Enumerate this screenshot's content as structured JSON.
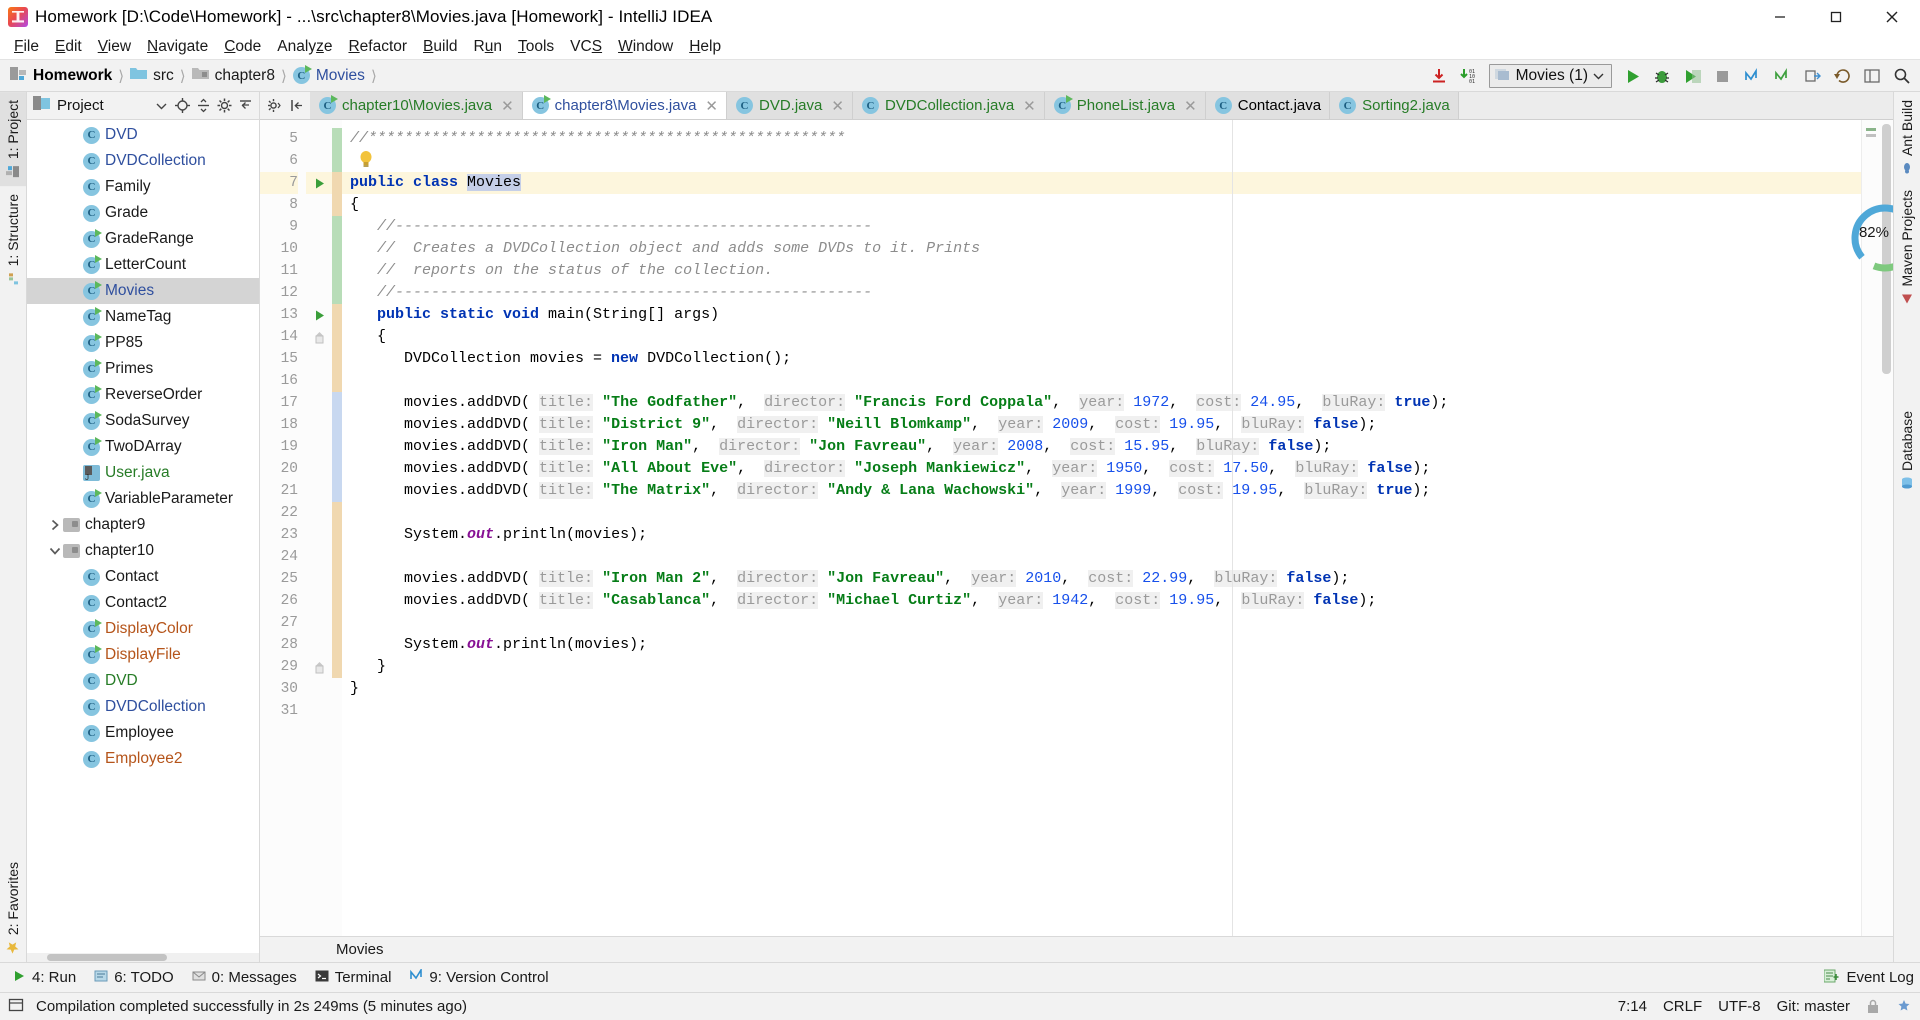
{
  "window": {
    "title": "Homework [D:\\Code\\Homework] - ...\\src\\chapter8\\Movies.java [Homework] - IntelliJ IDEA",
    "app_icon": "intellij-idea-icon",
    "minimize": "minimize-icon",
    "maximize": "maximize-icon",
    "close": "close-icon"
  },
  "menubar": {
    "items": [
      {
        "label": "File",
        "mnemonic": "F"
      },
      {
        "label": "Edit",
        "mnemonic": "E"
      },
      {
        "label": "View",
        "mnemonic": "V"
      },
      {
        "label": "Navigate",
        "mnemonic": "N"
      },
      {
        "label": "Code",
        "mnemonic": "C"
      },
      {
        "label": "Analyze",
        "mnemonic": "z"
      },
      {
        "label": "Refactor",
        "mnemonic": "R"
      },
      {
        "label": "Build",
        "mnemonic": "B"
      },
      {
        "label": "Run",
        "mnemonic": "u"
      },
      {
        "label": "Tools",
        "mnemonic": "T"
      },
      {
        "label": "VCS",
        "mnemonic": "S"
      },
      {
        "label": "Window",
        "mnemonic": "W"
      },
      {
        "label": "Help",
        "mnemonic": "H"
      }
    ]
  },
  "breadcrumb": {
    "items": [
      {
        "label": "Homework",
        "icon": "project-module-icon",
        "style": "project"
      },
      {
        "label": "src",
        "icon": "source-folder-icon",
        "style": "plain"
      },
      {
        "label": "chapter8",
        "icon": "package-folder-icon",
        "style": "plain"
      },
      {
        "label": "Movies",
        "icon": "java-class-icon",
        "style": "blue"
      }
    ]
  },
  "toolbar": {
    "update_project": "update-project-icon",
    "compile": "compile-icon",
    "run_config_label": "Movies (1)",
    "run_config_icon": "run-configuration-icon",
    "run": "run-icon",
    "debug": "debug-icon",
    "coverage": "run-with-coverage-icon",
    "vcs_update": "vcs-update-icon",
    "vcs_commit": "vcs-commit-icon",
    "vcs_push": "vcs-push-icon",
    "undo": "undo-icon",
    "layout": "layout-icon",
    "search": "search-everywhere-icon"
  },
  "left_stripe": {
    "top_tabs": [
      {
        "label": "1: Project",
        "icon": "project-tool-icon",
        "active": true
      },
      {
        "label": "1: Structure",
        "icon": "structure-tool-icon",
        "active": false
      }
    ],
    "bottom_tabs": [
      {
        "label": "2: Favorites",
        "icon": "favorites-star-icon",
        "active": false
      }
    ]
  },
  "right_stripe": {
    "tabs": [
      {
        "label": "Ant Build",
        "icon": "ant-build-icon"
      },
      {
        "label": "Maven Projects",
        "icon": "maven-icon"
      },
      {
        "label": "Database",
        "icon": "database-icon"
      }
    ]
  },
  "project_panel": {
    "title": "Project",
    "header_icons": [
      "project-view-icon",
      "chevron-down-icon",
      "locate-icon",
      "collapse-all-icon",
      "settings-gear-icon",
      "hide-icon"
    ],
    "tree": [
      {
        "label": "DVD",
        "icon": "java-class-icon",
        "runnable": false,
        "color": "blue",
        "indent": 3
      },
      {
        "label": "DVDCollection",
        "icon": "java-class-icon",
        "runnable": false,
        "color": "blue",
        "indent": 3
      },
      {
        "label": "Family",
        "icon": "java-class-icon",
        "runnable": false,
        "color": "black",
        "indent": 3
      },
      {
        "label": "Grade",
        "icon": "java-class-icon",
        "runnable": false,
        "color": "black",
        "indent": 3
      },
      {
        "label": "GradeRange",
        "icon": "java-class-icon",
        "runnable": true,
        "color": "black",
        "indent": 3
      },
      {
        "label": "LetterCount",
        "icon": "java-class-icon",
        "runnable": true,
        "color": "black",
        "indent": 3
      },
      {
        "label": "Movies",
        "icon": "java-class-icon",
        "runnable": true,
        "color": "blue",
        "indent": 3,
        "selected": true
      },
      {
        "label": "NameTag",
        "icon": "java-class-icon",
        "runnable": true,
        "color": "black",
        "indent": 3
      },
      {
        "label": "PP85",
        "icon": "java-class-icon",
        "runnable": true,
        "color": "black",
        "indent": 3
      },
      {
        "label": "Primes",
        "icon": "java-class-icon",
        "runnable": true,
        "color": "black",
        "indent": 3
      },
      {
        "label": "ReverseOrder",
        "icon": "java-class-icon",
        "runnable": true,
        "color": "black",
        "indent": 3
      },
      {
        "label": "SodaSurvey",
        "icon": "java-class-icon",
        "runnable": true,
        "color": "black",
        "indent": 3
      },
      {
        "label": "TwoDArray",
        "icon": "java-class-icon",
        "runnable": true,
        "color": "black",
        "indent": 3
      },
      {
        "label": "User.java",
        "icon": "java-file-icon",
        "runnable": false,
        "color": "green",
        "indent": 3
      },
      {
        "label": "VariableParameter",
        "icon": "java-class-icon",
        "runnable": true,
        "color": "black",
        "indent": 3
      },
      {
        "label": "chapter9",
        "icon": "package-folder-icon",
        "runnable": false,
        "color": "black",
        "indent": 2,
        "arrow": "collapsed"
      },
      {
        "label": "chapter10",
        "icon": "package-folder-icon",
        "runnable": false,
        "color": "black",
        "indent": 2,
        "arrow": "expanded"
      },
      {
        "label": "Contact",
        "icon": "java-class-icon",
        "runnable": false,
        "color": "black",
        "indent": 3
      },
      {
        "label": "Contact2",
        "icon": "java-class-icon",
        "runnable": false,
        "color": "black",
        "indent": 3
      },
      {
        "label": "DisplayColor",
        "icon": "java-class-icon",
        "runnable": true,
        "color": "orange",
        "indent": 3
      },
      {
        "label": "DisplayFile",
        "icon": "java-class-icon",
        "runnable": true,
        "color": "orange",
        "indent": 3
      },
      {
        "label": "DVD",
        "icon": "java-class-icon",
        "runnable": false,
        "color": "green",
        "indent": 3
      },
      {
        "label": "DVDCollection",
        "icon": "java-class-icon",
        "runnable": false,
        "color": "blue",
        "indent": 3
      },
      {
        "label": "Employee",
        "icon": "java-class-icon",
        "runnable": false,
        "color": "black",
        "indent": 3
      },
      {
        "label": "Employee2",
        "icon": "java-class-icon",
        "runnable": false,
        "color": "orange",
        "indent": 3
      }
    ]
  },
  "editor_tabs": [
    {
      "label": "chapter10\\Movies.java",
      "icon": "java-runnable-class-icon",
      "color": "green",
      "active": false,
      "closable": true
    },
    {
      "label": "chapter8\\Movies.java",
      "icon": "java-runnable-class-icon",
      "color": "blue",
      "active": true,
      "closable": true
    },
    {
      "label": "DVD.java",
      "icon": "java-class-icon",
      "color": "green",
      "active": false,
      "closable": true
    },
    {
      "label": "DVDCollection.java",
      "icon": "java-class-icon",
      "color": "green",
      "active": false,
      "closable": true
    },
    {
      "label": "PhoneList.java",
      "icon": "java-runnable-class-icon",
      "color": "green",
      "active": false,
      "closable": true
    },
    {
      "label": "Contact.java",
      "icon": "java-class-icon",
      "color": "black",
      "active": false,
      "closable": false
    },
    {
      "label": "Sorting2.java",
      "icon": "java-class-icon",
      "color": "green",
      "active": false,
      "closable": false
    }
  ],
  "editor": {
    "first_line_number": 5,
    "last_line_number": 31,
    "inspection_percent": "82%",
    "breadcrumb_bottom": "Movies",
    "lines": [
      {
        "n": 5,
        "html": "<span class=\"cm\">//*****************************************************</span>"
      },
      {
        "n": 6,
        "html": ""
      },
      {
        "n": 7,
        "html": "<span class=\"k\">public class</span> <span class=\"sel\">Movies</span>",
        "highlight": true,
        "gutter": "run-gutter-icon"
      },
      {
        "n": 8,
        "html": "{"
      },
      {
        "n": 9,
        "html": "   <span class=\"cm\">//-----------------------------------------------------</span>"
      },
      {
        "n": 10,
        "html": "   <span class=\"cm\">//  Creates a DVDCollection object and adds some DVDs to it. Prints</span>"
      },
      {
        "n": 11,
        "html": "   <span class=\"cm\">//  reports on the status of the collection.</span>"
      },
      {
        "n": 12,
        "html": "   <span class=\"cm\">//-----------------------------------------------------</span>"
      },
      {
        "n": 13,
        "html": "   <span class=\"k\">public static void</span> main(String[] args)",
        "gutter": "run-gutter-icon"
      },
      {
        "n": 14,
        "html": "   {",
        "fold": true
      },
      {
        "n": 15,
        "html": "      DVDCollection movies = <span class=\"k\">new</span> DVDCollection();"
      },
      {
        "n": 16,
        "html": ""
      },
      {
        "n": 17,
        "html": "      movies.addDVD( <span class=\"hint\">title:</span> <span class=\"st\">\"The Godfather\"</span>,  <span class=\"hint\">director:</span> <span class=\"st\">\"Francis Ford Coppala\"</span>,  <span class=\"hint\">year:</span> <span class=\"nm\">1972</span>,  <span class=\"hint\">cost:</span> <span class=\"nm\">24.95</span>,  <span class=\"hint\">bluRay:</span> <span class=\"k\">true</span>);"
      },
      {
        "n": 18,
        "html": "      movies.addDVD( <span class=\"hint\">title:</span> <span class=\"st\">\"District 9\"</span>,  <span class=\"hint\">director:</span> <span class=\"st\">\"Neill Blomkamp\"</span>,  <span class=\"hint\">year:</span> <span class=\"nm\">2009</span>,  <span class=\"hint\">cost:</span> <span class=\"nm\">19.95</span>,  <span class=\"hint\">bluRay:</span> <span class=\"k\">false</span>);"
      },
      {
        "n": 19,
        "html": "      movies.addDVD( <span class=\"hint\">title:</span> <span class=\"st\">\"Iron Man\"</span>,  <span class=\"hint\">director:</span> <span class=\"st\">\"Jon Favreau\"</span>,  <span class=\"hint\">year:</span> <span class=\"nm\">2008</span>,  <span class=\"hint\">cost:</span> <span class=\"nm\">15.95</span>,  <span class=\"hint\">bluRay:</span> <span class=\"k\">false</span>);"
      },
      {
        "n": 20,
        "html": "      movies.addDVD( <span class=\"hint\">title:</span> <span class=\"st\">\"All About Eve\"</span>,  <span class=\"hint\">director:</span> <span class=\"st\">\"Joseph Mankiewicz\"</span>,  <span class=\"hint\">year:</span> <span class=\"nm\">1950</span>,  <span class=\"hint\">cost:</span> <span class=\"nm\">17.50</span>,  <span class=\"hint\">bluRay:</span> <span class=\"k\">false</span>);"
      },
      {
        "n": 21,
        "html": "      movies.addDVD( <span class=\"hint\">title:</span> <span class=\"st\">\"The Matrix\"</span>,  <span class=\"hint\">director:</span> <span class=\"st\">\"Andy &amp; Lana Wachowski\"</span>,  <span class=\"hint\">year:</span> <span class=\"nm\">1999</span>,  <span class=\"hint\">cost:</span> <span class=\"nm\">19.95</span>,  <span class=\"hint\">bluRay:</span> <span class=\"k\">true</span>);"
      },
      {
        "n": 22,
        "html": ""
      },
      {
        "n": 23,
        "html": "      System.<span class=\"fld\">out</span>.println(movies);"
      },
      {
        "n": 24,
        "html": ""
      },
      {
        "n": 25,
        "html": "      movies.addDVD( <span class=\"hint\">title:</span> <span class=\"st\">\"Iron Man 2\"</span>,  <span class=\"hint\">director:</span> <span class=\"st\">\"Jon Favreau\"</span>,  <span class=\"hint\">year:</span> <span class=\"nm\">2010</span>,  <span class=\"hint\">cost:</span> <span class=\"nm\">22.99</span>,  <span class=\"hint\">bluRay:</span> <span class=\"k\">false</span>);"
      },
      {
        "n": 26,
        "html": "      movies.addDVD( <span class=\"hint\">title:</span> <span class=\"st\">\"Casablanca\"</span>,  <span class=\"hint\">director:</span> <span class=\"st\">\"Michael Curtiz\"</span>,  <span class=\"hint\">year:</span> <span class=\"nm\">1942</span>,  <span class=\"hint\">cost:</span> <span class=\"nm\">19.95</span>,  <span class=\"hint\">bluRay:</span> <span class=\"k\">false</span>);"
      },
      {
        "n": 27,
        "html": ""
      },
      {
        "n": 28,
        "html": "      System.<span class=\"fld\">out</span>.println(movies);"
      },
      {
        "n": 29,
        "html": "   }",
        "fold": true
      },
      {
        "n": 30,
        "html": "}"
      },
      {
        "n": 31,
        "html": ""
      }
    ]
  },
  "bottom_toolwindows": [
    {
      "label": "4: Run",
      "icon": "run-toolwindow-icon",
      "active": false
    },
    {
      "label": "6: TODO",
      "icon": "todo-icon",
      "active": false
    },
    {
      "label": "0: Messages",
      "icon": "messages-icon",
      "active": false
    },
    {
      "label": "Terminal",
      "icon": "terminal-icon",
      "active": false
    },
    {
      "label": "9: Version Control",
      "icon": "version-control-icon",
      "active": false
    }
  ],
  "event_log": {
    "label": "Event Log",
    "icon": "event-log-icon"
  },
  "statusbar": {
    "message": "Compilation completed successfully in 2s 249ms (5 minutes ago)",
    "toggle_icon": "toggle-toolbar-icon",
    "caret_position": "7:14",
    "line_separator": "CRLF",
    "encoding": "UTF-8",
    "git_branch": "Git: master",
    "lock_icon": "lock-icon",
    "inspection_icon": "inspection-icon"
  },
  "colors": {
    "accent_blue": "#2f4f9e",
    "green": "#277c27",
    "orange": "#b5541a",
    "string_green": "#067d17",
    "keyword_blue": "#0033b3",
    "number_blue": "#1750eb",
    "comment_gray": "#8c8c8c",
    "highlight_line": "#fdf6dd",
    "selection": "#c5cfe8"
  }
}
